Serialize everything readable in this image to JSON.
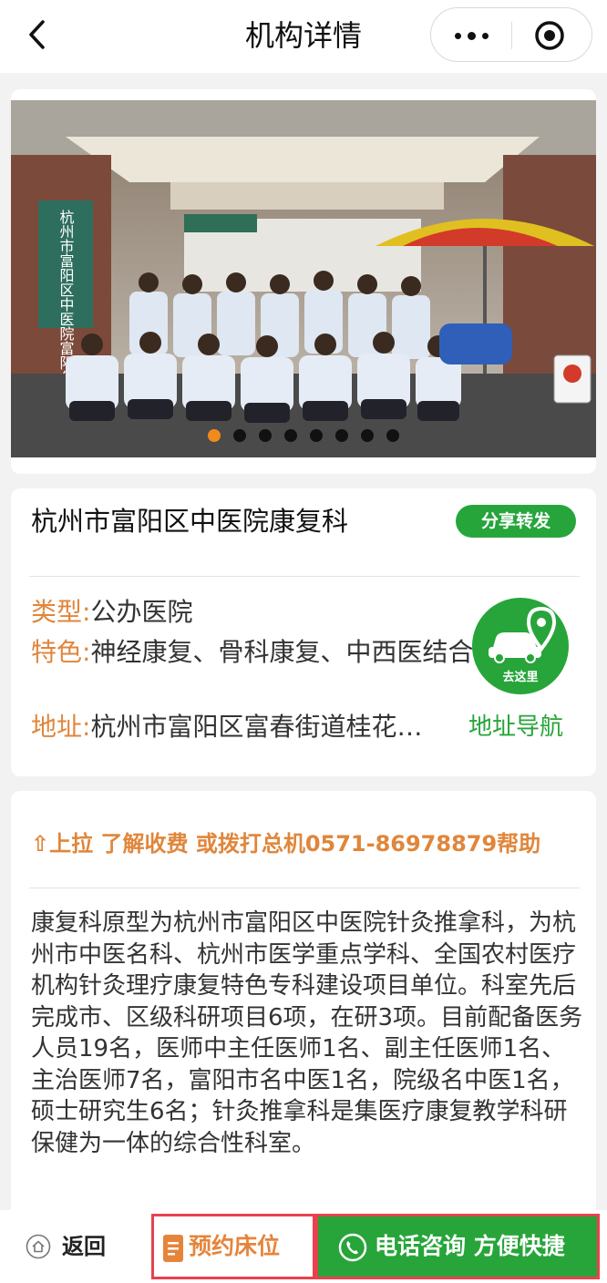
{
  "nav": {
    "title": "机构详情",
    "back_icon": "chevron-left-icon",
    "more_icon": "more-dots-icon",
    "close_icon": "target-circle-icon"
  },
  "banner": {
    "image_desc": "photo",
    "sign_left": "杭州市富阳区中医院富阳分院",
    "dot_count": 8,
    "active_dot": 0
  },
  "institution": {
    "name": "杭州市富阳区中医院康复科",
    "share_label": "分享转发",
    "type_label": "类型:",
    "type_value": "公办医院",
    "feature_label": "特色:",
    "feature_value": "神经康复、骨科康复、中西医结合",
    "address_label": "地址:",
    "address_value": "杭州市富阳区富春街道桂花…",
    "nav_link_label": "地址导航",
    "go_label": "去这里"
  },
  "description": {
    "hint": "⇧上拉 了解收费 或拨打总机0571-86978879帮助",
    "text": "康复科原型为杭州市富阳区中医院针灸推拿科，为杭州市中医名科、杭州市医学重点学科、全国农村医疗机构针灸理疗康复特色专科建设项目单位。科室先后完成市、区级科研项目6项，在研3项。目前配备医务人员19名，医师中主任医师1名、副主任医师1名、主治医师7名，富阳市名中医1名，院级名中医1名，硕士研究生6名；针灸推拿科是集医疗康复教学科研保健为一体的综合性科室。"
  },
  "bottom": {
    "back_label": "返回",
    "reserve_label": "预约床位",
    "phone_label": "电话咨询 方便快捷"
  },
  "colors": {
    "accent_green": "#27a53a",
    "accent_orange": "#e0863b",
    "highlight_red": "#e8414f"
  }
}
